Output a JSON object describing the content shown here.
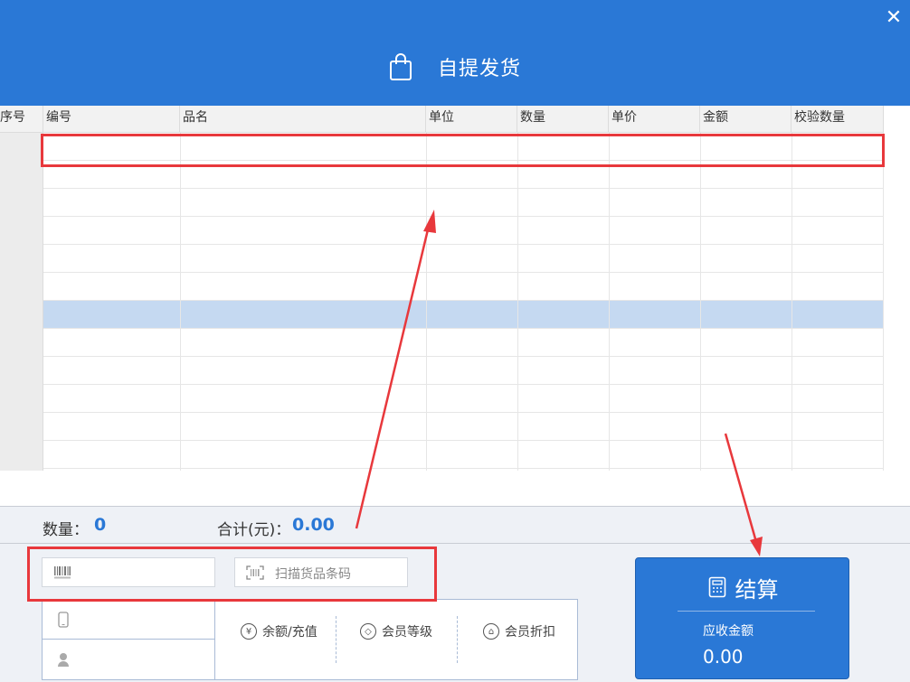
{
  "header": {
    "title": "自提发货",
    "close_symbol": "✕",
    "background_color": "#2a78d6"
  },
  "table": {
    "columns": [
      "序号",
      "编号",
      "品名",
      "单位",
      "数量",
      "单价",
      "金额",
      "校验数量"
    ],
    "row_count": 12,
    "selected_row_index": 6,
    "selected_color": "#c5d9f1"
  },
  "totals": {
    "quantity_label": "数量：",
    "quantity_value": "0",
    "sum_label": "合计(元)：",
    "sum_value": "0.00",
    "value_color": "#2a78d6"
  },
  "inputs": {
    "barcode_icon": "barcode-icon",
    "scan_placeholder": "扫描货品条码"
  },
  "member": {
    "phone_icon": "phone-icon",
    "user_icon": "user-icon",
    "balance_label": "余额/充值",
    "level_label": "会员等级",
    "discount_label": "会员折扣"
  },
  "checkout": {
    "label": "结算",
    "receivable_label": "应收金额",
    "receivable_value": "0.00"
  },
  "annotations": {
    "color": "#e8383c"
  }
}
